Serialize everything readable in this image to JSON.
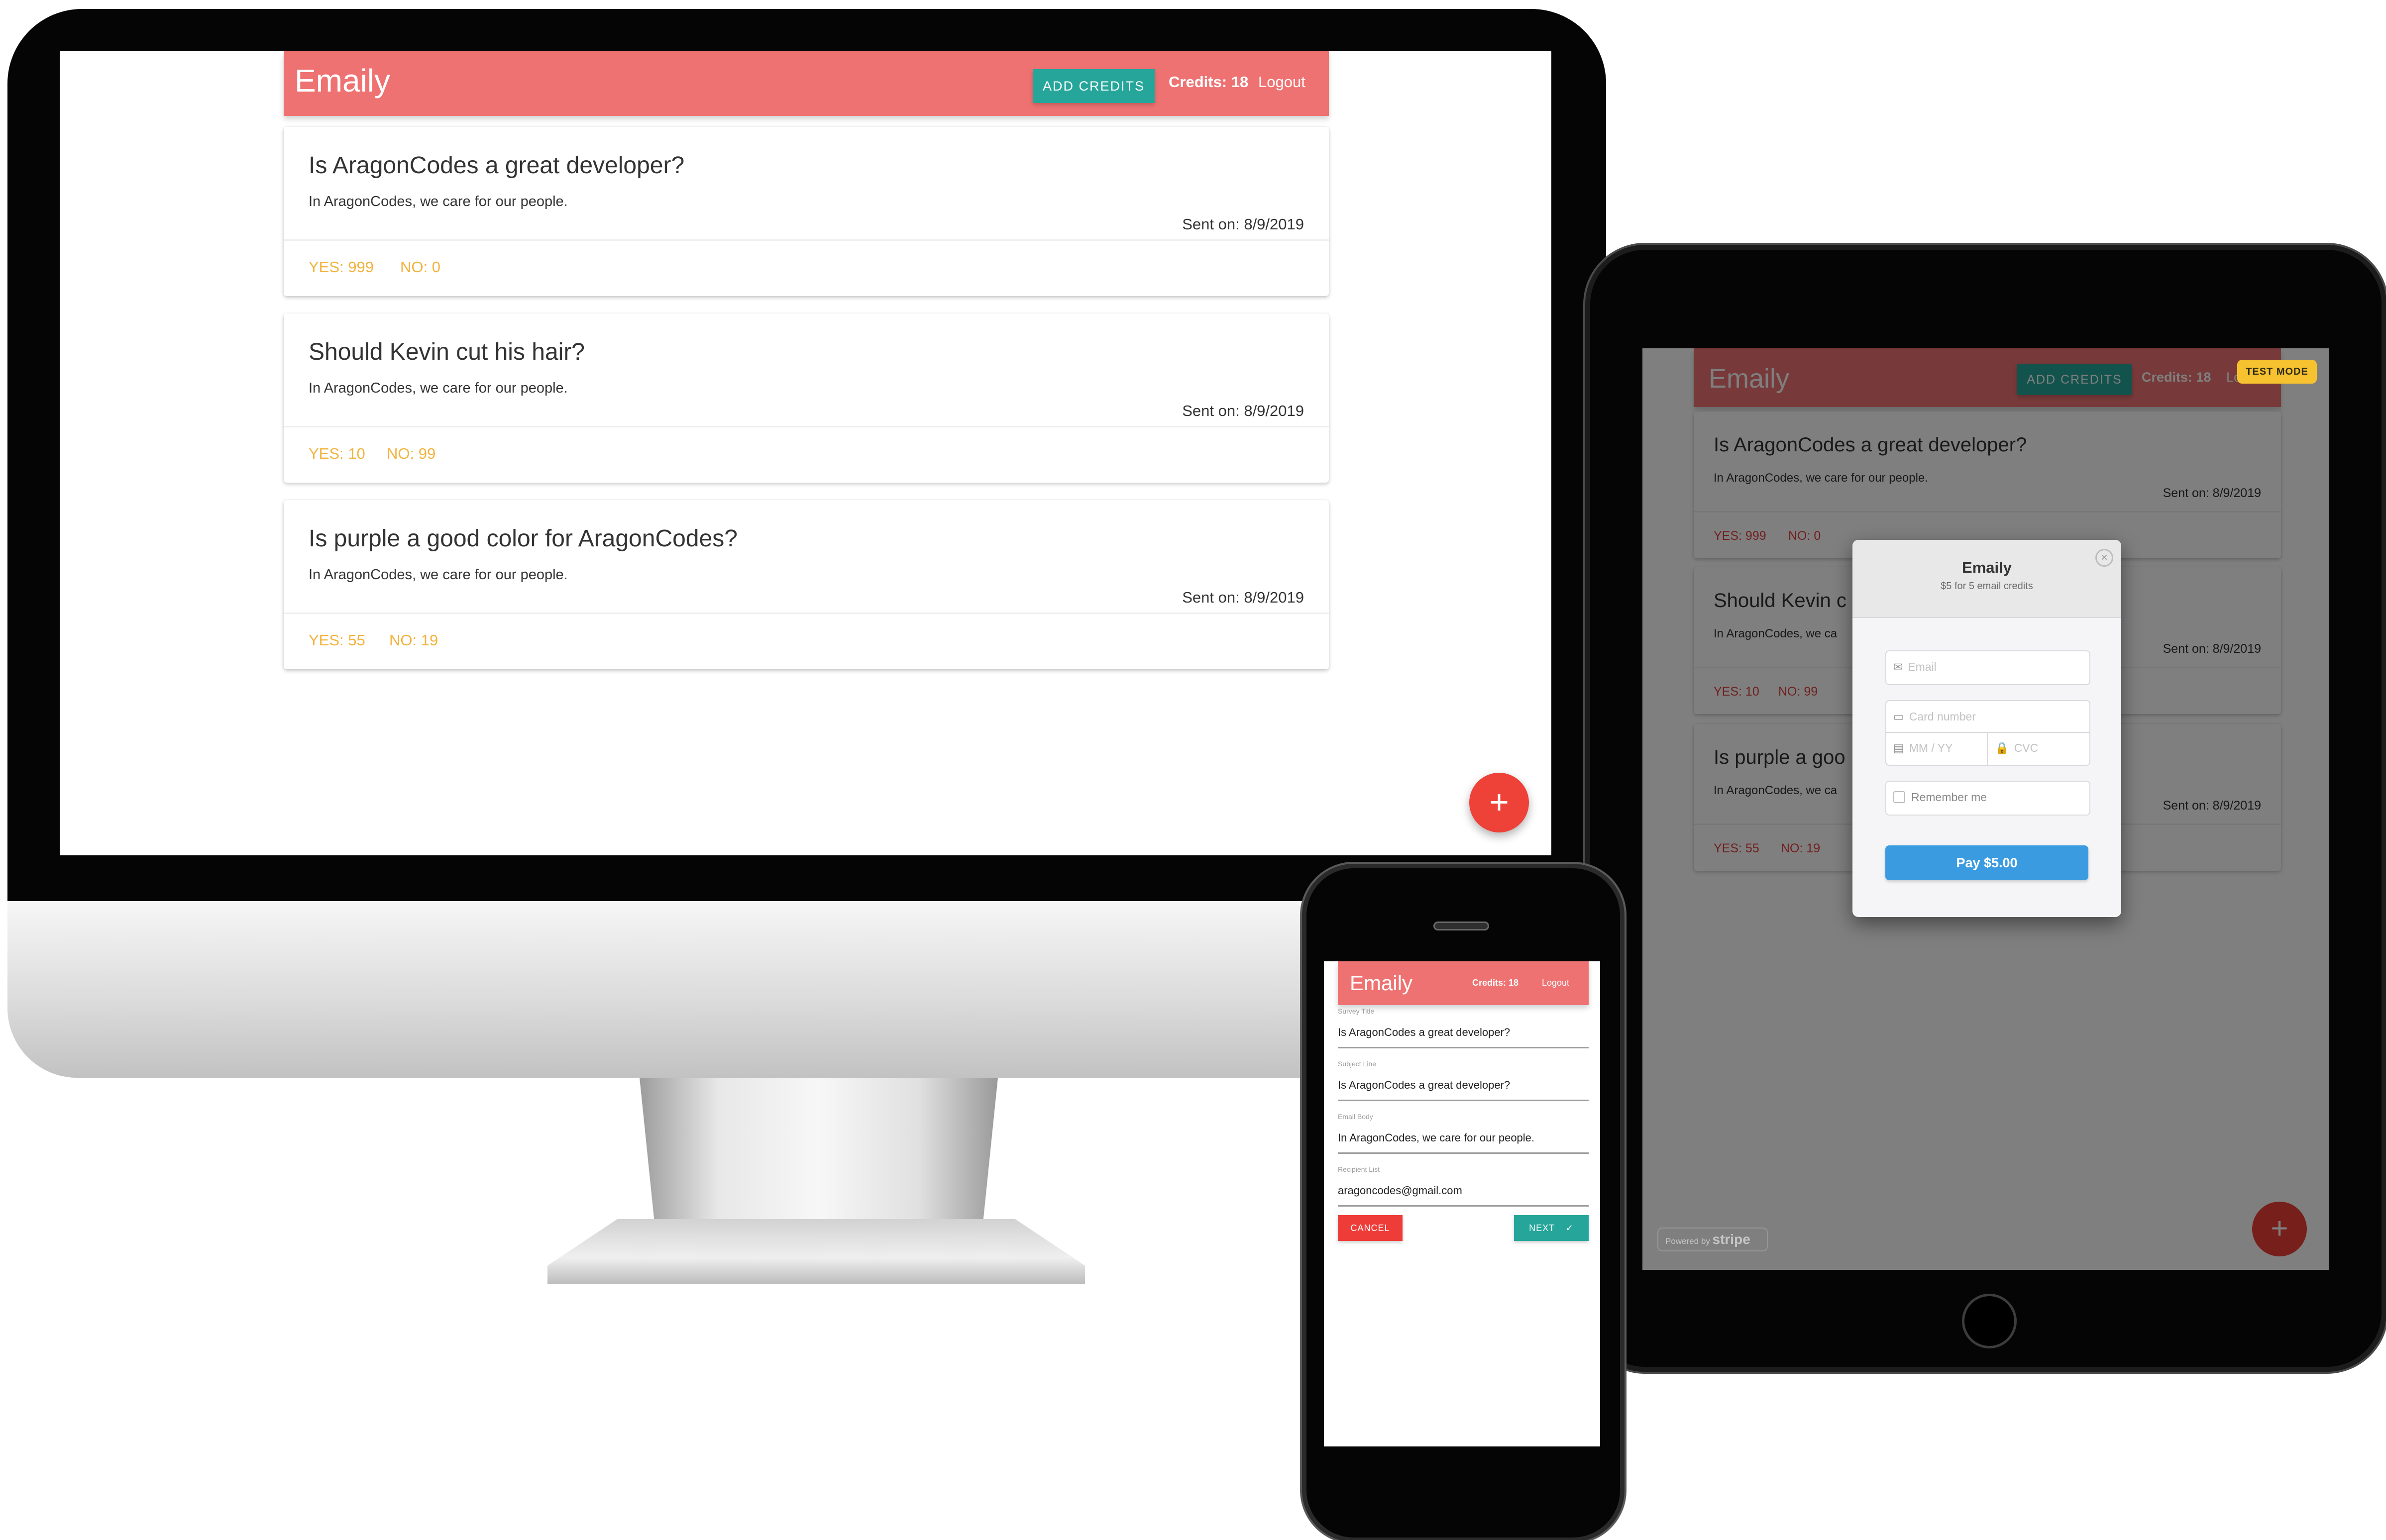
{
  "app": {
    "brand": "Emaily",
    "add_credits_label": "ADD CREDITS",
    "credits_text": "Credits: 18",
    "logout_label": "Logout",
    "fab_label": "+"
  },
  "surveys": [
    {
      "title": "Is AragonCodes a great developer?",
      "body": "In AragonCodes, we care for our people.",
      "sent": "Sent on: 8/9/2019",
      "yes": "YES: 999",
      "no": "NO: 0"
    },
    {
      "title": "Should Kevin cut his hair?",
      "body": "In AragonCodes, we care for our people.",
      "sent": "Sent on: 8/9/2019",
      "yes": "YES: 10",
      "no": "NO: 99"
    },
    {
      "title": "Is purple a good color for AragonCodes?",
      "body": "In AragonCodes, we care for our people.",
      "sent": "Sent on: 8/9/2019",
      "yes": "YES: 55",
      "no": "NO: 19"
    }
  ],
  "tablet": {
    "surveys_visible": [
      {
        "title": "Is AragonCodes a great developer?",
        "body": "In AragonCodes, we care for our people.",
        "sent": "Sent on: 8/9/2019",
        "yes": "YES: 999",
        "no": "NO: 0"
      },
      {
        "title": "Should Kevin c",
        "body": "In AragonCodes, we ca",
        "sent": "Sent on: 8/9/2019",
        "yes": "YES: 10",
        "no": "NO: 99"
      },
      {
        "title": "Is purple a goo",
        "body": "In AragonCodes, we ca",
        "sent": "Sent on: 8/9/2019",
        "yes": "YES: 55",
        "no": "NO: 19"
      }
    ],
    "logout_partial": "Lo",
    "test_mode": "TEST MODE",
    "powered_by": "Powered by",
    "stripe": "stripe"
  },
  "checkout": {
    "title": "Emaily",
    "subtitle": "$5 for 5 email credits",
    "email_placeholder": "Email",
    "card_placeholder": "Card number",
    "expiry_placeholder": "MM / YY",
    "cvc_placeholder": "CVC",
    "remember_label": "Remember me",
    "pay_label": "Pay $5.00",
    "close_glyph": "×"
  },
  "phone_form": {
    "fields": [
      {
        "label": "Survey Title",
        "value": "Is AragonCodes a great developer?"
      },
      {
        "label": "Subject Line",
        "value": "Is AragonCodes a great developer?"
      },
      {
        "label": "Email Body",
        "value": "In AragonCodes, we care for our people."
      },
      {
        "label": "Recipient List",
        "value": "aragoncodes@gmail.com"
      }
    ],
    "cancel_label": "CANCEL",
    "next_label": "NEXT",
    "next_icon": "check-icon"
  },
  "colors": {
    "navbar": "#ef7272",
    "teal": "#26a69a",
    "fab": "#ee4137",
    "vote_text": "#f2b33d",
    "stripe_pay": "#3b9be0",
    "test_mode": "#f6c230"
  }
}
